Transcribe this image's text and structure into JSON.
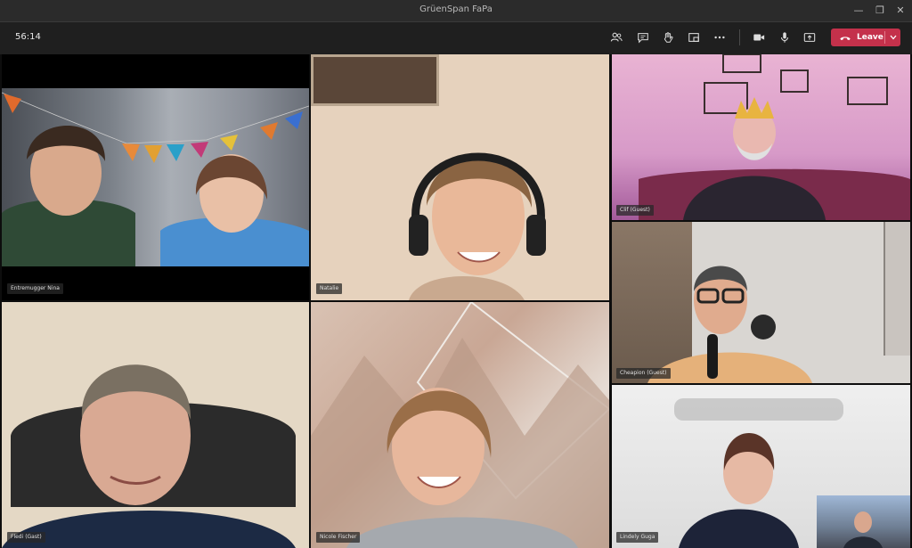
{
  "window": {
    "title": "GrüenSpan FaPa",
    "min_glyph": "—",
    "max_glyph": "❐",
    "close_glyph": "✕"
  },
  "toolbar": {
    "timer": "56:14",
    "icons": [
      "participants-icon",
      "chat-icon",
      "raise-hand-icon",
      "breakout-icon",
      "more-icon",
      "camera-icon",
      "mic-icon",
      "share-icon"
    ],
    "leave_label": "Leave"
  },
  "tiles": [
    {
      "id": "tile-1",
      "name": "Entremugger Nina"
    },
    {
      "id": "tile-2",
      "name": "Natalie"
    },
    {
      "id": "tile-3",
      "name": "Clif (Guest)"
    },
    {
      "id": "tile-4",
      "name": "Cheapion (Guest)"
    },
    {
      "id": "tile-5",
      "name": "Fledi (Gast)"
    },
    {
      "id": "tile-6",
      "name": "Nicole Fischer"
    },
    {
      "id": "tile-7",
      "name": "Lindely Guga"
    }
  ],
  "colors": {
    "leave": "#c4314b",
    "titlebar": "#2b2b2b",
    "toolbar": "#1f1f1f"
  }
}
